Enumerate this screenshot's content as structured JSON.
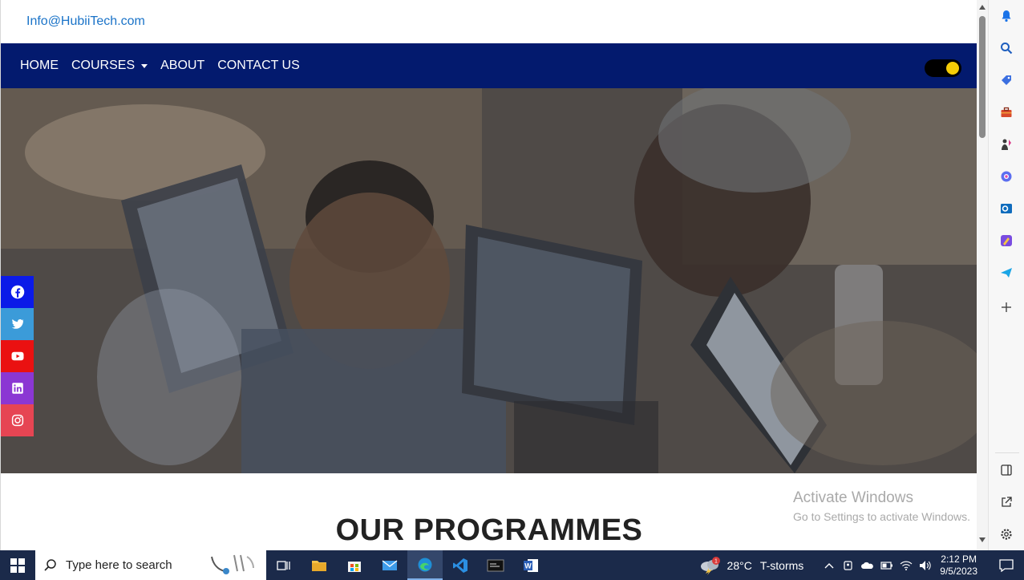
{
  "contact": {
    "email": "Info@HubiiTech.com"
  },
  "nav": {
    "items": [
      "HOME",
      "COURSES",
      "ABOUT",
      "CONTACT US"
    ],
    "theme_toggle": "on"
  },
  "social": [
    "facebook",
    "twitter",
    "youtube",
    "linkedin",
    "instagram"
  ],
  "section": {
    "title": "OUR PROGRAMMES"
  },
  "watermark": {
    "line1": "Activate Windows",
    "line2": "Go to Settings to activate Windows."
  },
  "taskbar": {
    "search_placeholder": "Type here to search",
    "weather": {
      "temp": "28°C",
      "condition": "T-storms",
      "alert_count": "1"
    },
    "time": "2:12 PM",
    "date": "9/5/2023"
  },
  "colors": {
    "navbar": "#031a6e",
    "toggle_knob": "#f5cd07",
    "link": "#1a73c8"
  }
}
